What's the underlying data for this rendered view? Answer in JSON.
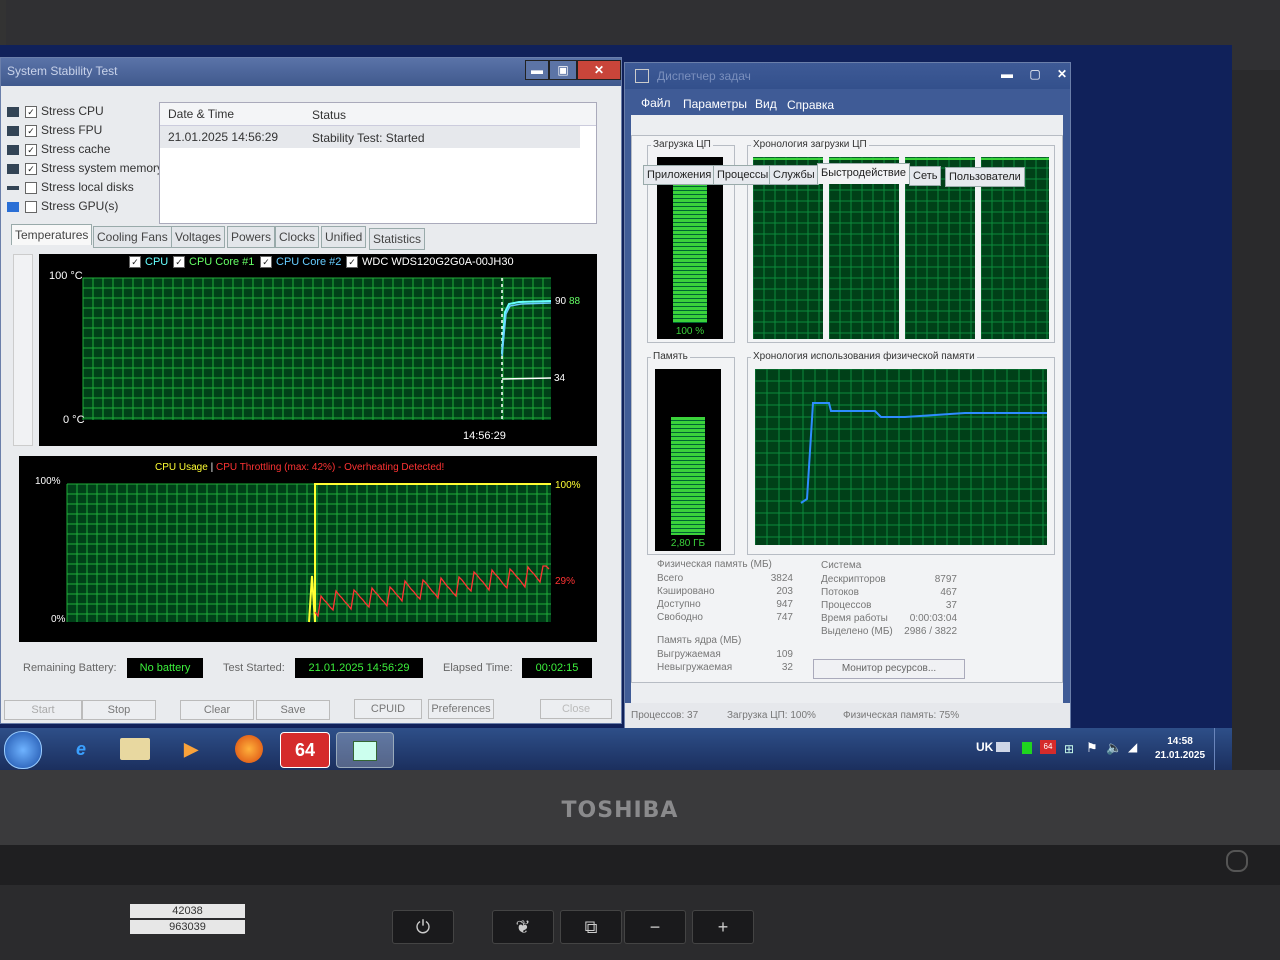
{
  "sst": {
    "title": "System Stability Test",
    "options": [
      {
        "label": "Stress CPU",
        "checked": true
      },
      {
        "label": "Stress FPU",
        "checked": true
      },
      {
        "label": "Stress cache",
        "checked": true
      },
      {
        "label": "Stress system memory",
        "checked": true
      },
      {
        "label": "Stress local disks",
        "checked": false
      },
      {
        "label": "Stress GPU(s)",
        "checked": false
      }
    ],
    "log": {
      "col_date": "Date & Time",
      "col_status": "Status",
      "rows": [
        {
          "date": "21.01.2025 14:56:29",
          "status": "Stability Test: Started"
        }
      ]
    },
    "tabs": [
      "Temperatures",
      "Cooling Fans",
      "Voltages",
      "Powers",
      "Clocks",
      "Unified",
      "Statistics"
    ],
    "temp_graph": {
      "legend": [
        "CPU",
        "CPU Core #1",
        "CPU Core #2",
        "WDC WDS120G2G0A-00JH30"
      ],
      "y_top": "100 °C",
      "y_bottom": "0 °C",
      "time_label": "14:56:29",
      "value_label_1": "90",
      "value_label_2": "88",
      "value_label_3": "34"
    },
    "usage_graph": {
      "title_usage": "CPU Usage",
      "separator": "|",
      "title_throttle": "CPU Throttling (max: 42%) - Overheating Detected!",
      "y_top": "100%",
      "y_bottom": "0%",
      "right_top": "100%",
      "right_mid": "29%"
    },
    "status": {
      "battery_label": "Remaining Battery:",
      "battery_value": "No battery",
      "started_label": "Test Started:",
      "started_value": "21.01.2025 14:56:29",
      "elapsed_label": "Elapsed Time:",
      "elapsed_value": "00:02:15"
    },
    "buttons": {
      "start": "Start",
      "stop": "Stop",
      "clear": "Clear",
      "save": "Save",
      "cpuid": "CPUID",
      "preferences": "Preferences",
      "close": "Close"
    }
  },
  "tm": {
    "title": "Диспетчер задач",
    "menu": [
      "Файл",
      "Параметры",
      "Вид",
      "Справка"
    ],
    "tabs": [
      "Приложения",
      "Процессы",
      "Службы",
      "Быстродействие",
      "Сеть",
      "Пользователи"
    ],
    "cpu_load_label": "Загрузка ЦП",
    "cpu_load_value": "100 %",
    "cpu_history_label": "Хронология загрузки ЦП",
    "memory_label": "Память",
    "memory_value": "2,80 ГБ",
    "memory_history_label": "Хронология использования физической памяти",
    "phys_mem": {
      "header": "Физическая память (МБ)",
      "rows": [
        {
          "label": "Всего",
          "value": "3824"
        },
        {
          "label": "Кэшировано",
          "value": "203"
        },
        {
          "label": "Доступно",
          "value": "947"
        },
        {
          "label": "Свободно",
          "value": "747"
        }
      ]
    },
    "kernel_mem": {
      "header": "Память ядра (МБ)",
      "rows": [
        {
          "label": "Выгружаемая",
          "value": "109"
        },
        {
          "label": "Невыгружаемая",
          "value": "32"
        }
      ]
    },
    "system": {
      "header": "Система",
      "rows": [
        {
          "label": "Дескрипторов",
          "value": "8797"
        },
        {
          "label": "Потоков",
          "value": "467"
        },
        {
          "label": "Процессов",
          "value": "37"
        },
        {
          "label": "Время работы",
          "value": "0:00:03:04"
        },
        {
          "label": "Выделено (МБ)",
          "value": "2986 / 3822"
        }
      ]
    },
    "resource_monitor_button": "Монитор ресурсов...",
    "statusbar": {
      "processes": "Процессов: 37",
      "cpu": "Загрузка ЦП: 100%",
      "memory": "Физическая память: 75%"
    }
  },
  "taskbar": {
    "aida_label": "64",
    "lang": "UK",
    "time": "14:58",
    "date": "21.01.2025"
  },
  "laptop": {
    "brand": "TOSHIBA",
    "sticker_1": "42038",
    "sticker_2": "963039"
  }
}
